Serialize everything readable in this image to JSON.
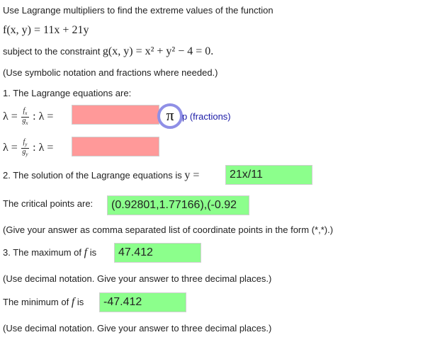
{
  "intro": "Use Lagrange multipliers to find the extreme values of the function",
  "function_expr": "f(x, y) = 11x + 21y",
  "constraint_prefix": "subject to the constraint ",
  "constraint_expr": "g(x, y) = x² + y² − 4 = 0.",
  "symbolic_note": "(Use symbolic notation and fractions where needed.)",
  "q1": {
    "label": "1. The Lagrange equations are:",
    "lambda": "λ =",
    "colon_lambda": ": λ =",
    "frac1_num": "f",
    "frac1_num_sub": "x",
    "frac1_den": "g",
    "frac1_den_sub": "x",
    "frac2_num": "f",
    "frac2_num_sub": "y",
    "frac2_den": "g",
    "frac2_den_sub": "y",
    "answer1": "",
    "answer2": "",
    "pi_symbol": "π",
    "hint": "p (fractions)"
  },
  "q2": {
    "label": "2. The solution of the Lagrange equations is",
    "var": "y =",
    "answer": "21x/11"
  },
  "critical": {
    "label": "The critical points are:",
    "answer": "(0.92801,1.77166),(-0.92"
  },
  "coord_note": "(Give your answer as comma separated list of coordinate points in the form (*,*).)",
  "q3": {
    "label": "3. The maximum of",
    "f": "f",
    "is": "is",
    "answer": "47.412"
  },
  "decimal_note1": "(Use decimal notation. Give your answer to three decimal places.)",
  "min": {
    "label": "The minimum of",
    "f": "f",
    "is": "is",
    "answer": "-47.412"
  },
  "decimal_note2": "(Use decimal notation. Give your answer to three decimal places.)",
  "colors": {
    "correct": "#8cff8c",
    "incorrect": "#ff9999",
    "pi_ring": "#8f8fe6",
    "hint_link": "#1a1aa6"
  }
}
